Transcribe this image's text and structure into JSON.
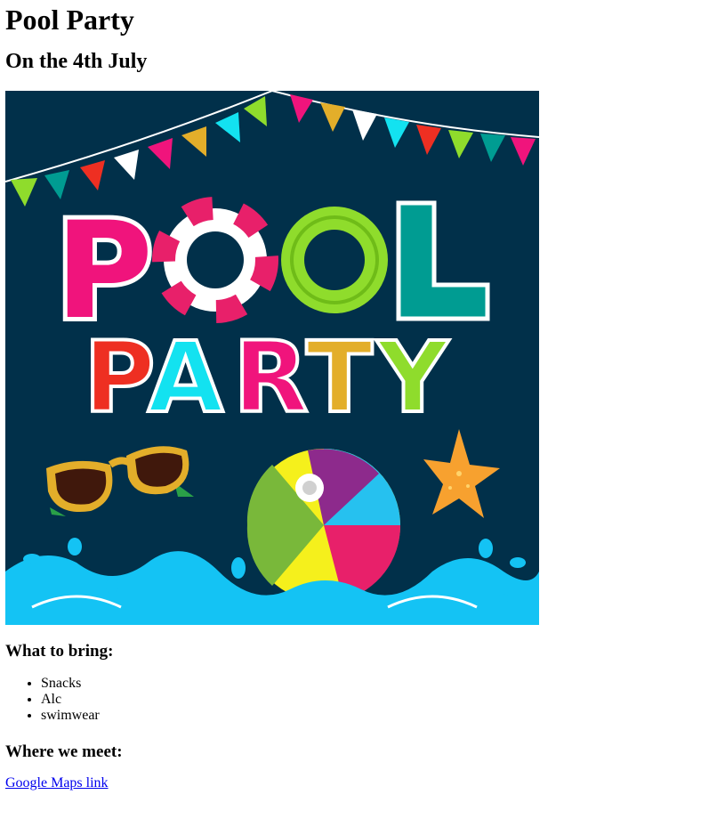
{
  "page": {
    "title": "Pool Party",
    "subtitle": "On the 4th July"
  },
  "poster": {
    "line1": "POOL",
    "line2": "PARTY",
    "colors": {
      "background": "#01304a",
      "p": "#f0147c",
      "ring_red": "#e8206a",
      "o_green": "#8fdc2c",
      "l_teal": "#009c92",
      "party_p": "#ee2f22",
      "party_a": "#13e2f0",
      "party_r": "#f0147c",
      "party_t": "#e3ae2a",
      "party_y": "#8fdc2c",
      "water": "#14c3f4",
      "sunglasses_frame": "#e3ae2a",
      "starfish": "#f7a12f"
    },
    "icons": [
      "bunting-flags",
      "swim-ring",
      "sunglasses",
      "beach-ball",
      "starfish",
      "water-splash"
    ]
  },
  "sections": {
    "bring_heading": "What to bring:",
    "bring_items": [
      "Snacks",
      "Alc",
      "swimwear"
    ],
    "meet_heading": "Where we meet:",
    "maps_link": "Google Maps link"
  }
}
